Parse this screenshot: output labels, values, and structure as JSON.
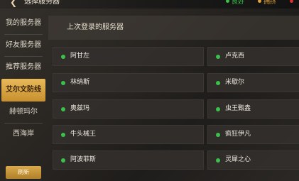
{
  "header": {
    "title": "选择服务器",
    "legend": [
      {
        "label": "良好",
        "color": "#3ac14a"
      },
      {
        "label": "拥挤",
        "color": "#e0a23a"
      },
      {
        "label": "",
        "color": "#d83030"
      }
    ]
  },
  "sidebar": {
    "items": [
      {
        "label": "我的服务器",
        "active": false
      },
      {
        "label": "好友服务器",
        "active": false
      },
      {
        "label": "推荐服务器",
        "active": false
      },
      {
        "label": "艾尔文防线",
        "active": true
      },
      {
        "label": "赫顿玛尔",
        "active": false
      },
      {
        "label": "西海岸",
        "active": false
      }
    ],
    "refresh_label": "刷新"
  },
  "panel": {
    "title": "上次登录的服务器",
    "servers": [
      {
        "name": "阿甘左",
        "status": "良好"
      },
      {
        "name": "卢克西",
        "status": "良好"
      },
      {
        "name": "林纳斯",
        "status": "良好"
      },
      {
        "name": "米歇尔",
        "status": "良好"
      },
      {
        "name": "奥兹玛",
        "status": "良好"
      },
      {
        "name": "虫王甄盎",
        "status": "良好"
      },
      {
        "name": "牛头械王",
        "status": "良好"
      },
      {
        "name": "疯狂伊凡",
        "status": "良好"
      },
      {
        "name": "阿波菲斯",
        "status": "良好"
      },
      {
        "name": "灵犀之心",
        "status": "良好"
      }
    ]
  }
}
